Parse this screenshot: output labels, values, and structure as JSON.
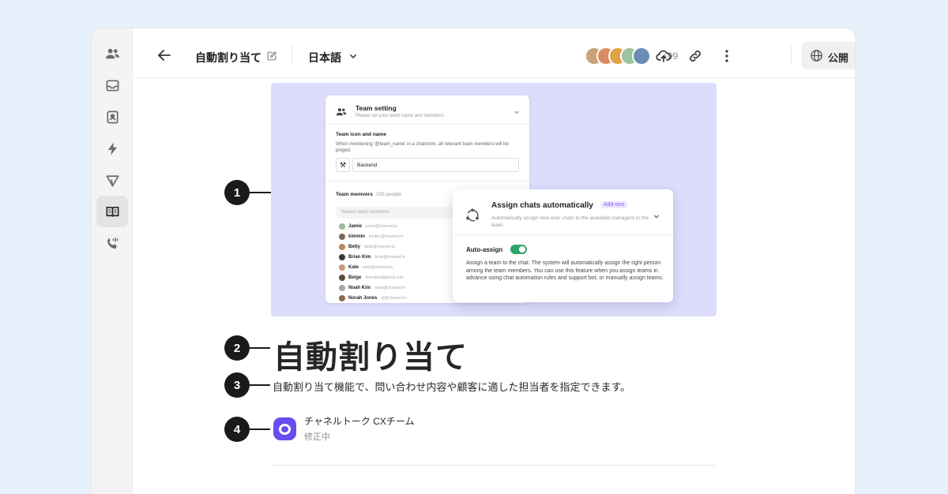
{
  "colors": {
    "page_bg": "#e6f1fb",
    "hero_bg": "#dcdcfc",
    "brand": "#6a4cf0",
    "toggle_on": "#30a46c",
    "addon_text": "#8a5cf0"
  },
  "sidebar": {
    "items": [
      {
        "icon": "people-icon",
        "active": false
      },
      {
        "icon": "inbox-icon",
        "active": false
      },
      {
        "icon": "contact-icon",
        "active": false
      },
      {
        "icon": "lightning-icon",
        "active": false
      },
      {
        "icon": "send-icon",
        "active": false
      },
      {
        "icon": "book-icon",
        "active": true
      },
      {
        "icon": "phone-icon",
        "active": false
      }
    ]
  },
  "header": {
    "title": "自動割り当て",
    "language": "日本語",
    "collaborators_extra": "+99",
    "publish_label": "公開"
  },
  "hero": {
    "team_setting": {
      "title": "Team setting",
      "subtitle": "Please set your team name and members.",
      "icon_name_label": "Team icon and name",
      "icon_name_desc": "When mentioning '@team_name' in a chatroom, all relevant team members will be pinged.",
      "emoji": "⚒",
      "team_name": "Backend",
      "members_label": "Team memvers",
      "members_count": "105 people",
      "search_placeholder": "Search team members",
      "members": [
        {
          "name": "Jamie",
          "email": "jamie@channel.io"
        },
        {
          "name": "kimmin",
          "email": "kimkim@channel.io"
        },
        {
          "name": "Betty",
          "email": "betty@channel.io"
        },
        {
          "name": "Brian Kim",
          "email": "brian@channel.io"
        },
        {
          "name": "Kate",
          "email": "katie@channel.io"
        },
        {
          "name": "Beige",
          "email": "foonation@gmail.com"
        },
        {
          "name": "Noah Kim",
          "email": "noah@channel.io"
        },
        {
          "name": "Norah Jones",
          "email": "nj@channel.io"
        }
      ]
    },
    "assign_card": {
      "title": "Assign chats automatically",
      "badge": "Add-ons",
      "desc": "Automatically assign new user chats to the available managers in the team.",
      "auto_label": "Auto-assign",
      "auto_on": true,
      "auto_desc": "Assign a team to the chat. The system will automatically assign the right person among the team members. You can use this feature when you assign teams in advance using chat automation rules and support bot, or manually assign teams."
    }
  },
  "callouts": [
    "1",
    "2",
    "3",
    "4"
  ],
  "article": {
    "title": "自動割り当て",
    "description": "自動割り当て機能で、問い合わせ内容や顧客に適した担当者を指定できます。",
    "author": "チャネルトーク CXチーム",
    "status": "修正中"
  }
}
